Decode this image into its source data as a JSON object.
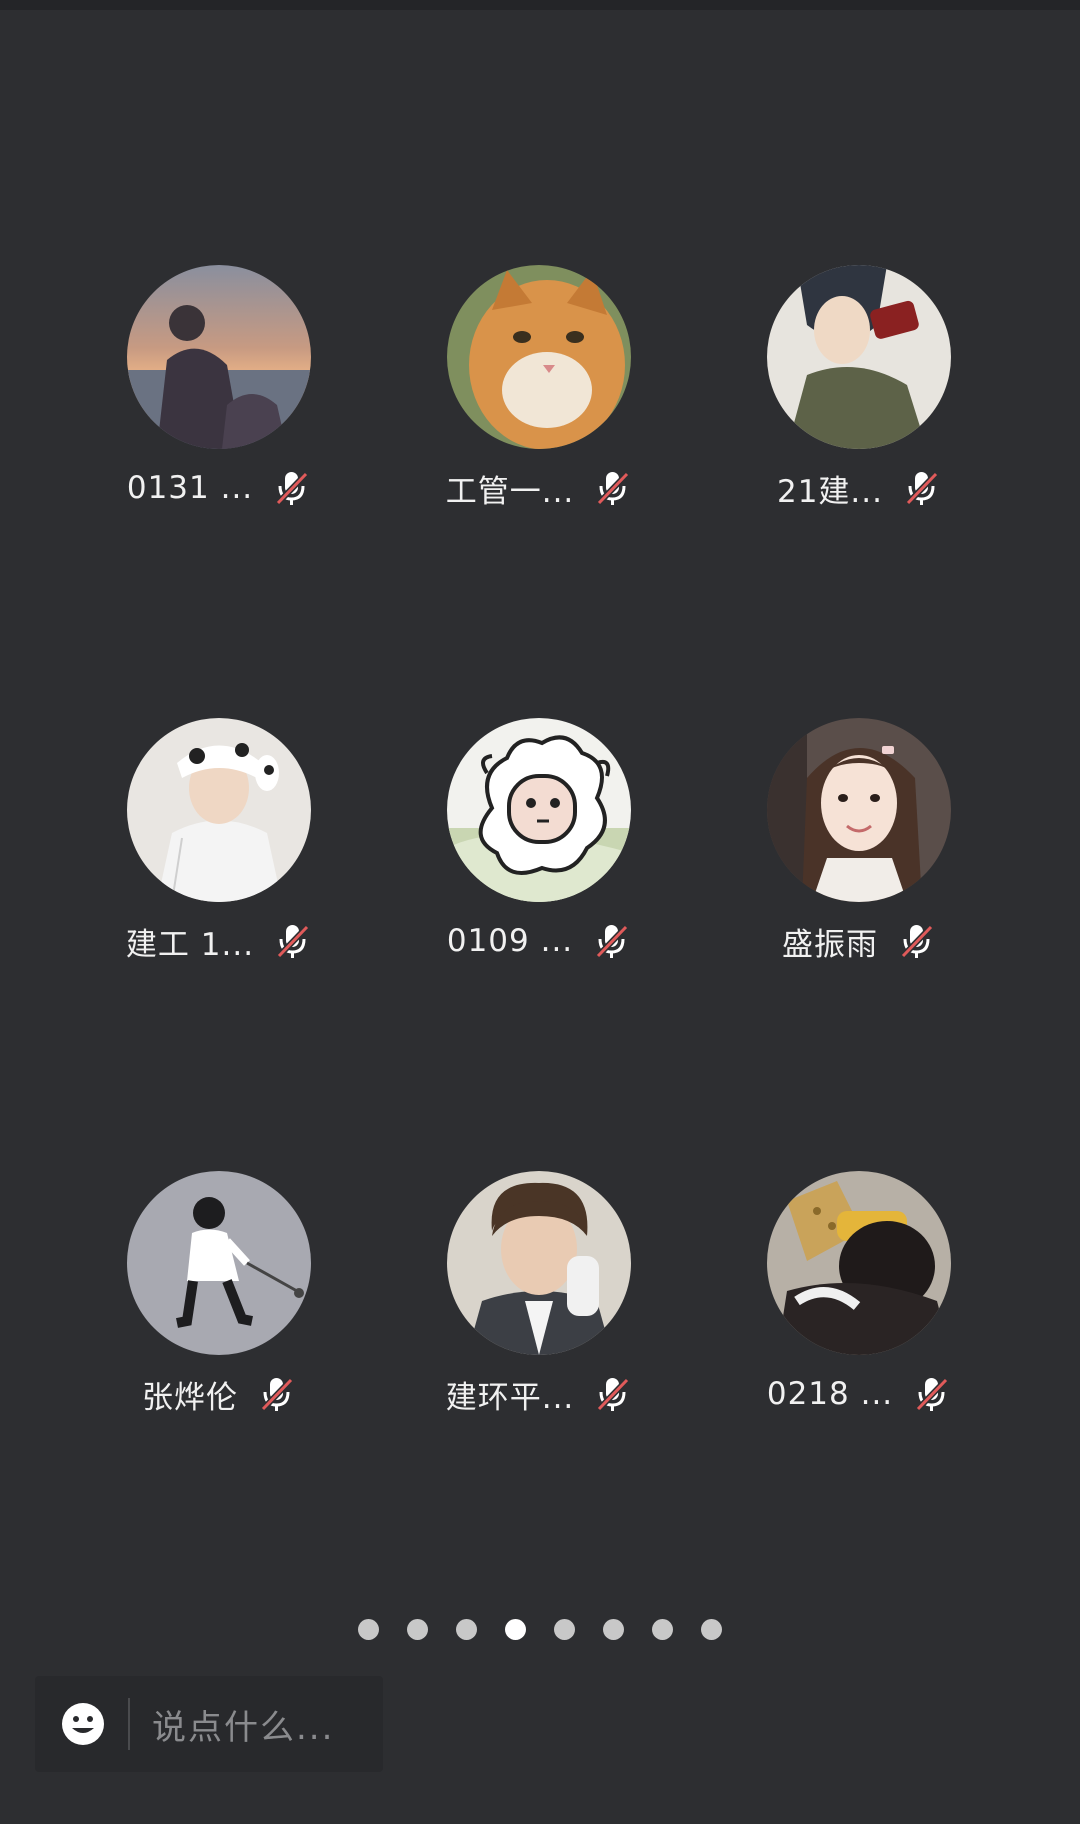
{
  "participants": [
    {
      "name": "0131 ...",
      "avatar_desc": "sunset-beach-photo"
    },
    {
      "name": "工管一...",
      "avatar_desc": "orange-cat-photo"
    },
    {
      "name": "21建...",
      "avatar_desc": "anime-girl-drinking"
    },
    {
      "name": "建工 1...",
      "avatar_desc": "person-cow-hat"
    },
    {
      "name": "0109 ...",
      "avatar_desc": "cartoon-sheep"
    },
    {
      "name": "盛振雨",
      "avatar_desc": "girl-portrait"
    },
    {
      "name": "张烨伦",
      "avatar_desc": "cartoon-boy-walking"
    },
    {
      "name": "建环平...",
      "avatar_desc": "boy-portrait"
    },
    {
      "name": "0218 ...",
      "avatar_desc": "child-with-hat"
    }
  ],
  "mic_status_icon": "mic-muted-icon",
  "pager": {
    "total": 8,
    "active_index": 3
  },
  "chat": {
    "placeholder": "说点什么..."
  },
  "colors": {
    "background": "#2d2e31",
    "mute_slash": "#e05a5a",
    "dot_active": "#ffffff",
    "dot_inactive": "#c8c8c8"
  }
}
